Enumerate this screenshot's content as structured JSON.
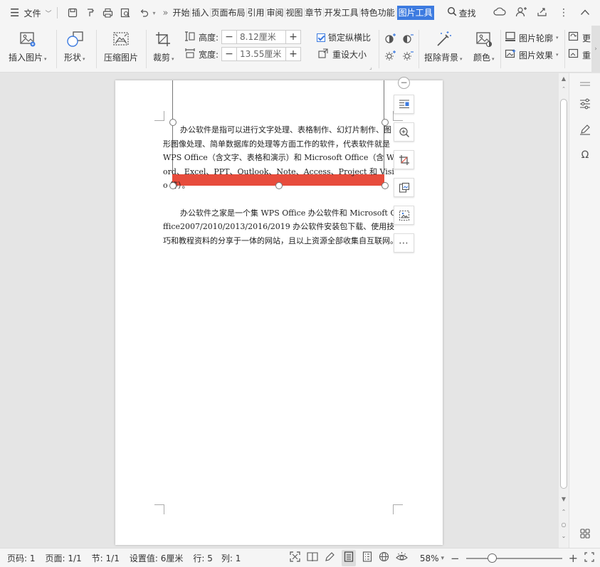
{
  "topbar": {
    "file_menu": "文件",
    "tabs": [
      {
        "label": "开始"
      },
      {
        "label": "插入"
      },
      {
        "label": "页面布局"
      },
      {
        "label": "引用"
      },
      {
        "label": "审阅"
      },
      {
        "label": "视图"
      },
      {
        "label": "章节"
      },
      {
        "label": "开发工具"
      },
      {
        "label": "特色功能"
      },
      {
        "label": "图片工具"
      }
    ],
    "active_tab": "图片工具",
    "search_label": "查找"
  },
  "ribbon": {
    "insert_picture": "插入图片",
    "shape": "形状",
    "compress": "压缩图片",
    "crop": "裁剪",
    "height_label": "高度:",
    "height_value": "8.12厘米",
    "width_label": "宽度:",
    "width_value": "13.55厘米",
    "lock_ratio": "锁定纵横比",
    "lock_ratio_checked": true,
    "reset_size": "重设大小",
    "remove_bg": "抠除背景",
    "color": "颜色",
    "outline": "图片轮廓",
    "effect": "图片效果",
    "more1": "更",
    "more2": "重"
  },
  "document": {
    "paragraphs": [
      "办公软件是指可以进行文字处理、表格制作、幻灯片制作、图形图像处理、简单数据库的处理等方面工作的软件，代表软件就是 WPS Office（含文字、表格和演示）和 Microsoft Office（含 Word、Excel、PPT、Outlook、Note、Access、Project 和 Visio 等）。",
      "办公软件之家是一个集 WPS Office 办公软件和 Microsoft Office2007/2010/2013/2016/2019 办公软件安装包下载、使用技巧和教程资料的分享于一体的网站，且以上资源全部收集自互联网。"
    ],
    "image_color": "#e74c3c"
  },
  "statusbar": {
    "page_code": "页码: 1",
    "pages": "页面: 1/1",
    "section": "节: 1/1",
    "setting": "设置值: 6厘米",
    "row": "行: 5",
    "col": "列: 1",
    "zoom": "58%",
    "zoom_fraction": 0.27
  },
  "colors": {
    "accent": "#3d7be0",
    "image_red": "#e74c3c"
  }
}
